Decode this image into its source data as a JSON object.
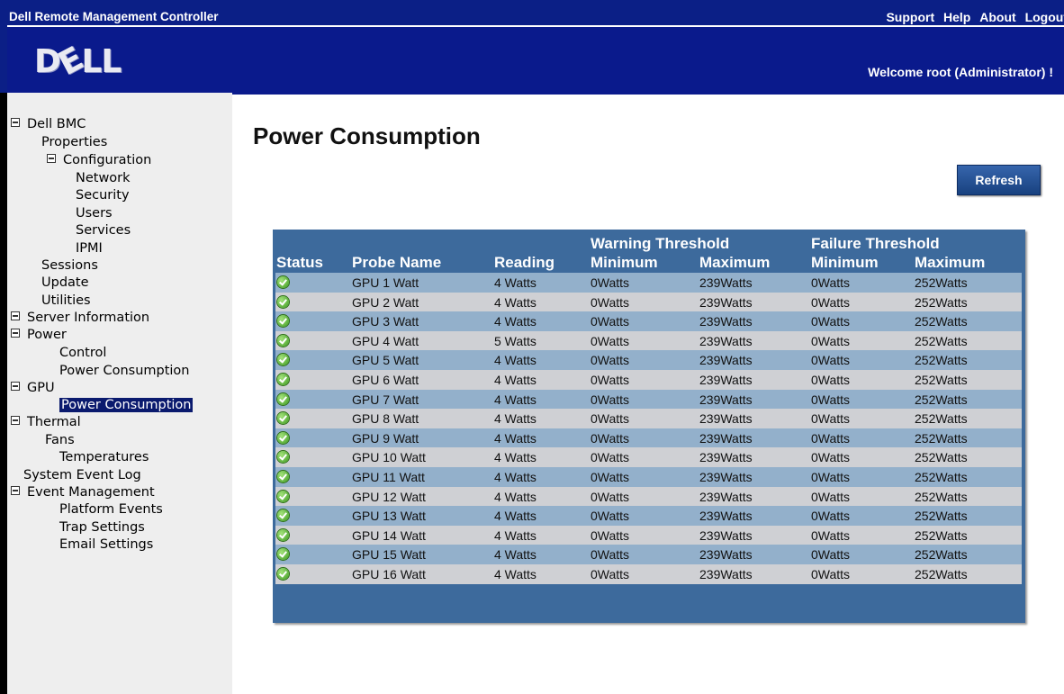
{
  "topbar": {
    "app_title": "Dell Remote Management Controller",
    "links": [
      "Support",
      "Help",
      "About",
      "Logout"
    ]
  },
  "header": {
    "logo_text": "DELL",
    "welcome": "Welcome root (Administrator) !"
  },
  "sidebar": {
    "items": [
      {
        "label": "Dell BMC",
        "expanded": true
      },
      {
        "label": "Properties"
      },
      {
        "label": "Configuration",
        "expanded": true
      },
      {
        "label": "Network"
      },
      {
        "label": "Security"
      },
      {
        "label": "Users"
      },
      {
        "label": "Services"
      },
      {
        "label": "IPMI"
      },
      {
        "label": "Sessions"
      },
      {
        "label": "Update"
      },
      {
        "label": "Utilities"
      },
      {
        "label": "Server Information",
        "expanded": true
      },
      {
        "label": "Power",
        "expanded": true
      },
      {
        "label": "Control"
      },
      {
        "label": "Power Consumption"
      },
      {
        "label": "GPU",
        "expanded": true
      },
      {
        "label": "Power Consumption",
        "selected": true
      },
      {
        "label": "Thermal",
        "expanded": true
      },
      {
        "label": "Fans"
      },
      {
        "label": "Temperatures"
      },
      {
        "label": "System Event Log"
      },
      {
        "label": "Event Management",
        "expanded": true
      },
      {
        "label": "Platform Events"
      },
      {
        "label": "Trap Settings"
      },
      {
        "label": "Email Settings"
      }
    ]
  },
  "main": {
    "title": "Power Consumption",
    "refresh_label": "Refresh",
    "table": {
      "group_headers": {
        "warning": "Warning Threshold",
        "failure": "Failure Threshold"
      },
      "columns": [
        "Status",
        "Probe Name",
        "Reading",
        "Minimum",
        "Maximum",
        "Minimum",
        "Maximum"
      ],
      "rows": [
        {
          "status": "ok",
          "probe": "GPU 1 Watt",
          "reading": "4 Watts",
          "warn_min": "0Watts",
          "warn_max": "239Watts",
          "fail_min": "0Watts",
          "fail_max": "252Watts"
        },
        {
          "status": "ok",
          "probe": "GPU 2 Watt",
          "reading": "4 Watts",
          "warn_min": "0Watts",
          "warn_max": "239Watts",
          "fail_min": "0Watts",
          "fail_max": "252Watts"
        },
        {
          "status": "ok",
          "probe": "GPU 3 Watt",
          "reading": "4 Watts",
          "warn_min": "0Watts",
          "warn_max": "239Watts",
          "fail_min": "0Watts",
          "fail_max": "252Watts"
        },
        {
          "status": "ok",
          "probe": "GPU 4 Watt",
          "reading": "5 Watts",
          "warn_min": "0Watts",
          "warn_max": "239Watts",
          "fail_min": "0Watts",
          "fail_max": "252Watts"
        },
        {
          "status": "ok",
          "probe": "GPU 5 Watt",
          "reading": "4 Watts",
          "warn_min": "0Watts",
          "warn_max": "239Watts",
          "fail_min": "0Watts",
          "fail_max": "252Watts"
        },
        {
          "status": "ok",
          "probe": "GPU 6 Watt",
          "reading": "4 Watts",
          "warn_min": "0Watts",
          "warn_max": "239Watts",
          "fail_min": "0Watts",
          "fail_max": "252Watts"
        },
        {
          "status": "ok",
          "probe": "GPU 7 Watt",
          "reading": "4 Watts",
          "warn_min": "0Watts",
          "warn_max": "239Watts",
          "fail_min": "0Watts",
          "fail_max": "252Watts"
        },
        {
          "status": "ok",
          "probe": "GPU 8 Watt",
          "reading": "4 Watts",
          "warn_min": "0Watts",
          "warn_max": "239Watts",
          "fail_min": "0Watts",
          "fail_max": "252Watts"
        },
        {
          "status": "ok",
          "probe": "GPU 9 Watt",
          "reading": "4 Watts",
          "warn_min": "0Watts",
          "warn_max": "239Watts",
          "fail_min": "0Watts",
          "fail_max": "252Watts"
        },
        {
          "status": "ok",
          "probe": "GPU 10 Watt",
          "reading": "4 Watts",
          "warn_min": "0Watts",
          "warn_max": "239Watts",
          "fail_min": "0Watts",
          "fail_max": "252Watts"
        },
        {
          "status": "ok",
          "probe": "GPU 11 Watt",
          "reading": "4 Watts",
          "warn_min": "0Watts",
          "warn_max": "239Watts",
          "fail_min": "0Watts",
          "fail_max": "252Watts"
        },
        {
          "status": "ok",
          "probe": "GPU 12 Watt",
          "reading": "4 Watts",
          "warn_min": "0Watts",
          "warn_max": "239Watts",
          "fail_min": "0Watts",
          "fail_max": "252Watts"
        },
        {
          "status": "ok",
          "probe": "GPU 13 Watt",
          "reading": "4 Watts",
          "warn_min": "0Watts",
          "warn_max": "239Watts",
          "fail_min": "0Watts",
          "fail_max": "252Watts"
        },
        {
          "status": "ok",
          "probe": "GPU 14 Watt",
          "reading": "4 Watts",
          "warn_min": "0Watts",
          "warn_max": "239Watts",
          "fail_min": "0Watts",
          "fail_max": "252Watts"
        },
        {
          "status": "ok",
          "probe": "GPU 15 Watt",
          "reading": "4 Watts",
          "warn_min": "0Watts",
          "warn_max": "239Watts",
          "fail_min": "0Watts",
          "fail_max": "252Watts"
        },
        {
          "status": "ok",
          "probe": "GPU 16 Watt",
          "reading": "4 Watts",
          "warn_min": "0Watts",
          "warn_max": "239Watts",
          "fail_min": "0Watts",
          "fail_max": "252Watts"
        }
      ]
    }
  },
  "colors": {
    "topbar": "#0b1f86",
    "header": "#0a1a8c",
    "table_header": "#3d6a9c",
    "row_odd": "#93b0cb",
    "row_even": "#cfd0d4",
    "status_ok": "#3c9a1e"
  }
}
